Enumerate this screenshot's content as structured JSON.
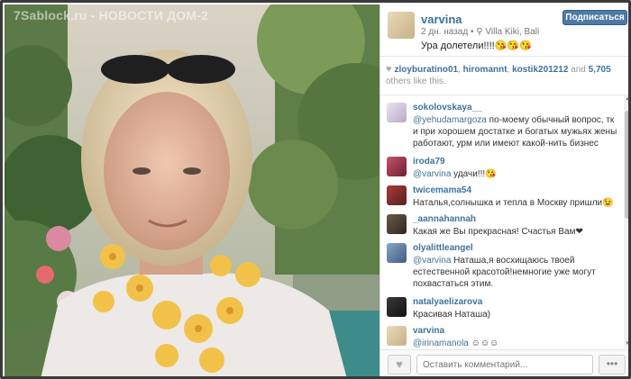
{
  "photo": {
    "watermark": "7Sablock.ru - НОВОСТИ ДОМ-2"
  },
  "post": {
    "owner": "varvina",
    "time_ago": "2 дн. назад",
    "location_icon": "location-pin-icon",
    "location": "Villa Kiki, Bali",
    "caption": "Ура долетели!!!!😘😘😘",
    "follow_label": "Подписаться"
  },
  "likes": {
    "heart_icon": "heart-icon",
    "users": [
      "zloyburatino01",
      "hiromannt",
      "kostik201212"
    ],
    "and": "and",
    "count": "5,705",
    "suffix": "others like this."
  },
  "comments": [
    {
      "user": "sokolovskaya__",
      "mention": "@yehudamargoza",
      "text": " по-моему обычный вопрос, тк и при хорошем достатке и богатых мужьях жены работают, урм или имеют какой-нить бизнес"
    },
    {
      "user": "iroda79",
      "mention": "@varvina",
      "text": " удачи!!!😘"
    },
    {
      "user": "twicemama54",
      "mention": "",
      "text": "Наталья,солнышка и тепла в Москву пришли😉"
    },
    {
      "user": "_aannahannah",
      "mention": "",
      "text": "Какая же Вы прекрасная! Счастья Вам❤"
    },
    {
      "user": "olyalittleangel",
      "mention": "@varvina",
      "text": " Наташа,я восхищаюсь твоей естественной красотой!немногие уже могут похвастаться этим."
    },
    {
      "user": "natalyaelizarova",
      "mention": "",
      "text": "Красивая Наташа)"
    },
    {
      "user": "varvina",
      "mention": "@irinamanola",
      "text": " ☺☺☺"
    }
  ],
  "footer": {
    "like_icon": "heart-icon",
    "comment_placeholder": "Оставить комментарий...",
    "more_label": "•••"
  },
  "colors": {
    "link": "#3f729b",
    "follow_button": "#4d7aa7"
  }
}
